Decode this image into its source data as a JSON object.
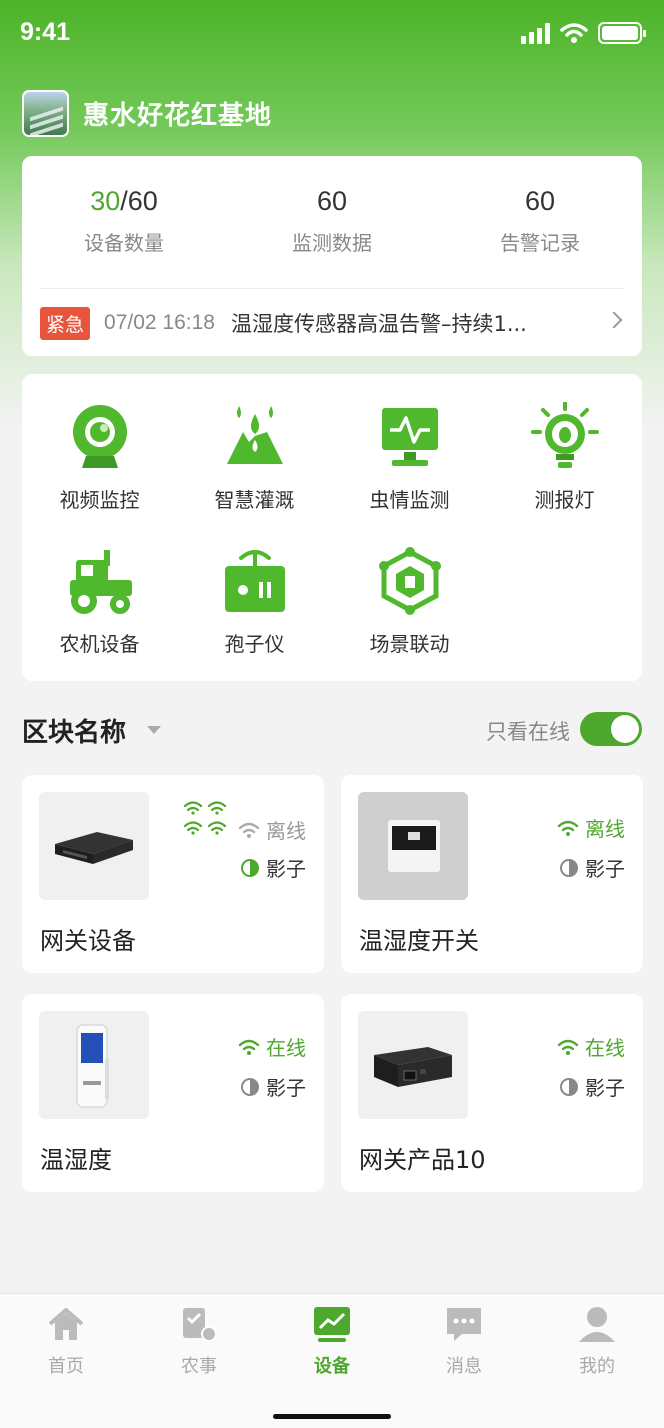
{
  "status_bar": {
    "time": "9:41"
  },
  "header": {
    "base_name": "惠水好花红基地"
  },
  "stats": {
    "device_count_online": "30",
    "device_count_total": "/60",
    "device_count_label": "设备数量",
    "monitor_count": "60",
    "monitor_label": "监测数据",
    "alarm_count": "60",
    "alarm_label": "告警记录"
  },
  "alert": {
    "badge": "紧急",
    "time": "07/02 16:18",
    "text": "温湿度传感器高温告警–持续1..."
  },
  "functions": [
    {
      "label": "视频监控",
      "icon": "camera-icon"
    },
    {
      "label": "智慧灌溉",
      "icon": "irrigation-icon"
    },
    {
      "label": "虫情监测",
      "icon": "monitor-icon"
    },
    {
      "label": "测报灯",
      "icon": "bulb-icon"
    },
    {
      "label": "农机设备",
      "icon": "tractor-icon"
    },
    {
      "label": "孢子仪",
      "icon": "spore-device-icon"
    },
    {
      "label": "场景联动",
      "icon": "scene-link-icon"
    }
  ],
  "section": {
    "title": "区块名称",
    "online_only_label": "只看在线",
    "online_only_on": true
  },
  "devices": [
    {
      "name": "网关设备",
      "status": "离线",
      "shadow": "影子"
    },
    {
      "name": "温湿度开关",
      "status": "离线",
      "shadow": "影子"
    },
    {
      "name": "温湿度",
      "status": "在线",
      "shadow": "影子"
    },
    {
      "name": "网关产品10",
      "status": "在线",
      "shadow": "影子"
    }
  ],
  "tabbar": [
    {
      "label": "首页",
      "icon": "home-icon",
      "active": false
    },
    {
      "label": "农事",
      "icon": "farm-work-icon",
      "active": false
    },
    {
      "label": "设备",
      "icon": "device-chart-icon",
      "active": true
    },
    {
      "label": "消息",
      "icon": "message-icon",
      "active": false
    },
    {
      "label": "我的",
      "icon": "user-icon",
      "active": false
    }
  ],
  "colors": {
    "accent": "#4fa82e",
    "alarm": "#ee6a3a",
    "urgent": "#e8553d"
  }
}
